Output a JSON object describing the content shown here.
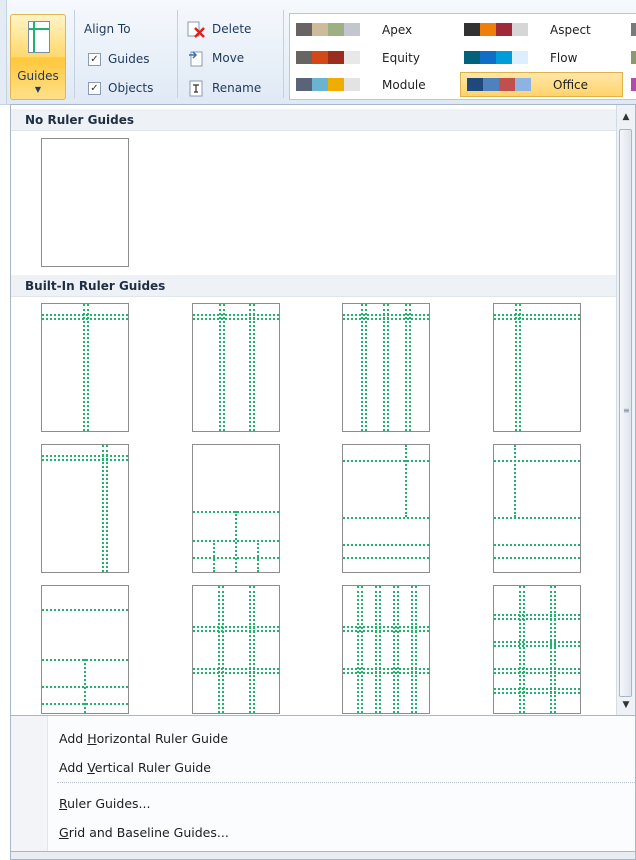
{
  "ribbon": {
    "guides_label": "Guides",
    "align_to": "Align To",
    "align_guides": "Guides",
    "align_objects": "Objects",
    "delete": "Delete",
    "move": "Move",
    "rename": "Rename",
    "themes": [
      {
        "name": "Apex",
        "colors": [
          "#696464",
          "#cebb9a",
          "#9cb084",
          "#c3c5cf"
        ]
      },
      {
        "name": "Aspect",
        "colors": [
          "#323232",
          "#f07f09",
          "#9f2936",
          "#d6d6d6"
        ]
      },
      {
        "name": "Equity",
        "colors": [
          "#696464",
          "#d34817",
          "#9b2d1f",
          "#e8e8e8"
        ]
      },
      {
        "name": "Flow",
        "colors": [
          "#04617b",
          "#0f6fc6",
          "#009dd9",
          "#dbefff"
        ]
      },
      {
        "name": "Module",
        "colors": [
          "#5a6378",
          "#6ab3d1",
          "#f0ad00",
          "#e3e3e3"
        ]
      },
      {
        "name": "Office",
        "colors": [
          "#1f497d",
          "#4f81bd",
          "#c0504d",
          "#8db3e2"
        ]
      }
    ],
    "selected_theme": "Office"
  },
  "gallery": {
    "no_guides_header": "No Ruler Guides",
    "builtin_header": "Built-In Ruler Guides"
  },
  "menu": {
    "add_horizontal_pre": "Add ",
    "add_horizontal_key": "H",
    "add_horizontal_post": "orizontal Ruler Guide",
    "add_vertical_pre": "Add ",
    "add_vertical_key": "V",
    "add_vertical_post": "ertical Ruler Guide",
    "ruler_guides_key": "R",
    "ruler_guides_post": "uler Guides...",
    "grid_key": "G",
    "grid_post": "rid and Baseline Guides..."
  },
  "colors": {
    "guide": "#1fb36d",
    "selected": "#ffd36b"
  }
}
